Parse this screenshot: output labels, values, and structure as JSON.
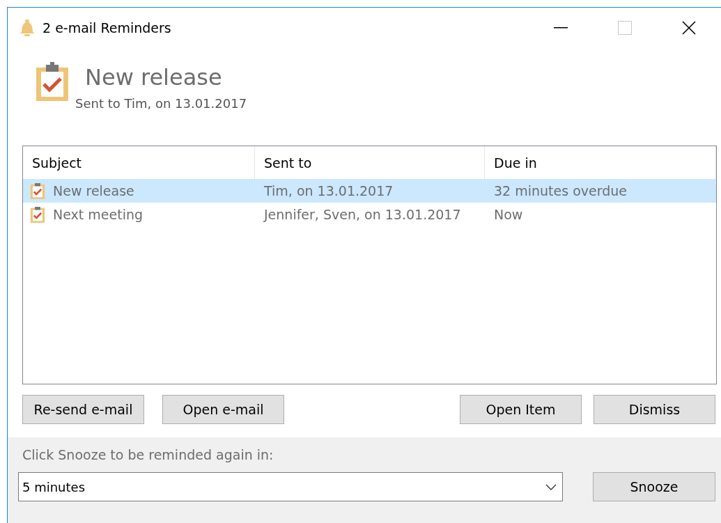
{
  "window": {
    "title": "2 e-mail Reminders",
    "controls": [
      {
        "kind": "minimize",
        "disabled": false
      },
      {
        "kind": "maximize",
        "disabled": true
      },
      {
        "kind": "close",
        "disabled": false
      }
    ]
  },
  "header": {
    "title": "New release",
    "subtitle": "Sent to Tim, on 13.01.2017"
  },
  "table": {
    "columns": [
      "Subject",
      "Sent to",
      "Due in"
    ],
    "rows": [
      {
        "subject": "New release",
        "sent_to": "Tim, on 13.01.2017",
        "due_in": "32 minutes overdue",
        "selected": true
      },
      {
        "subject": "Next meeting",
        "sent_to": "Jennifer, Sven, on 13.01.2017",
        "due_in": "Now",
        "selected": false
      }
    ]
  },
  "buttons": [
    "Re-send e-mail",
    "Open e-mail",
    "Open Item",
    "Dismiss"
  ],
  "snooze": {
    "label": "Click Snooze to be reminded again in:",
    "value": "5 minutes",
    "button": "Snooze"
  }
}
